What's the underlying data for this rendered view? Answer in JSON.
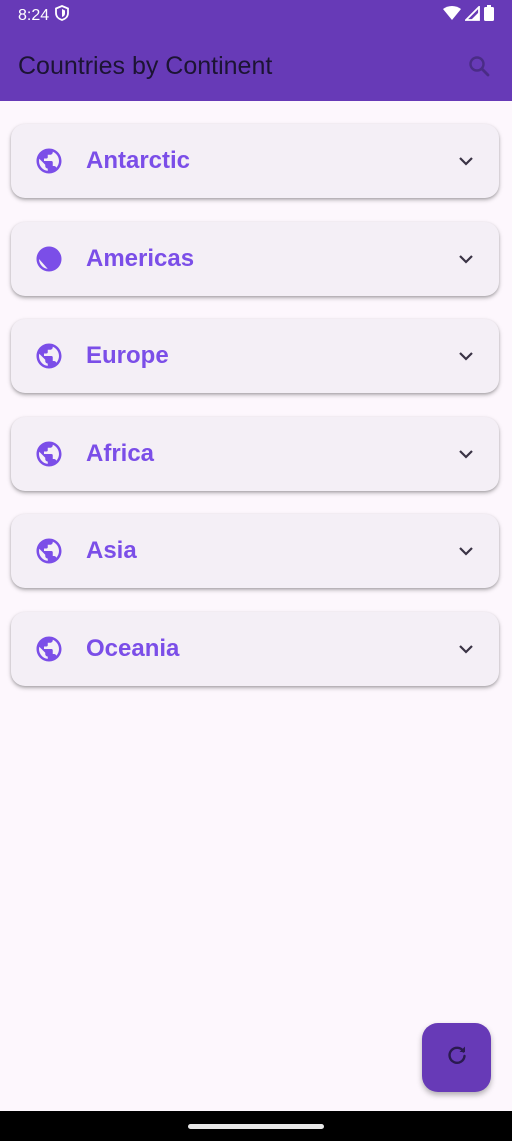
{
  "status_bar": {
    "time": "8:24",
    "icons": [
      "shield-icon",
      "wifi-icon",
      "signal-icon",
      "battery-icon"
    ]
  },
  "app_bar": {
    "title": "Countries by Continent",
    "action_icon": "search-icon"
  },
  "continents": [
    {
      "label": "Antarctic",
      "icon": "globe-icon",
      "expand_icon": "chevron-down-icon"
    },
    {
      "label": "Americas",
      "icon": "globe-icon",
      "expand_icon": "chevron-down-icon"
    },
    {
      "label": "Europe",
      "icon": "globe-icon",
      "expand_icon": "chevron-down-icon"
    },
    {
      "label": "Africa",
      "icon": "globe-icon",
      "expand_icon": "chevron-down-icon"
    },
    {
      "label": "Asia",
      "icon": "globe-icon",
      "expand_icon": "chevron-down-icon"
    },
    {
      "label": "Oceania",
      "icon": "globe-icon",
      "expand_icon": "chevron-down-icon"
    }
  ],
  "fab": {
    "icon": "refresh-icon"
  },
  "colors": {
    "primary": "#673ab7",
    "accent_text": "#7b4ee8",
    "background": "#fdf7fd",
    "card": "#f4eff6"
  }
}
